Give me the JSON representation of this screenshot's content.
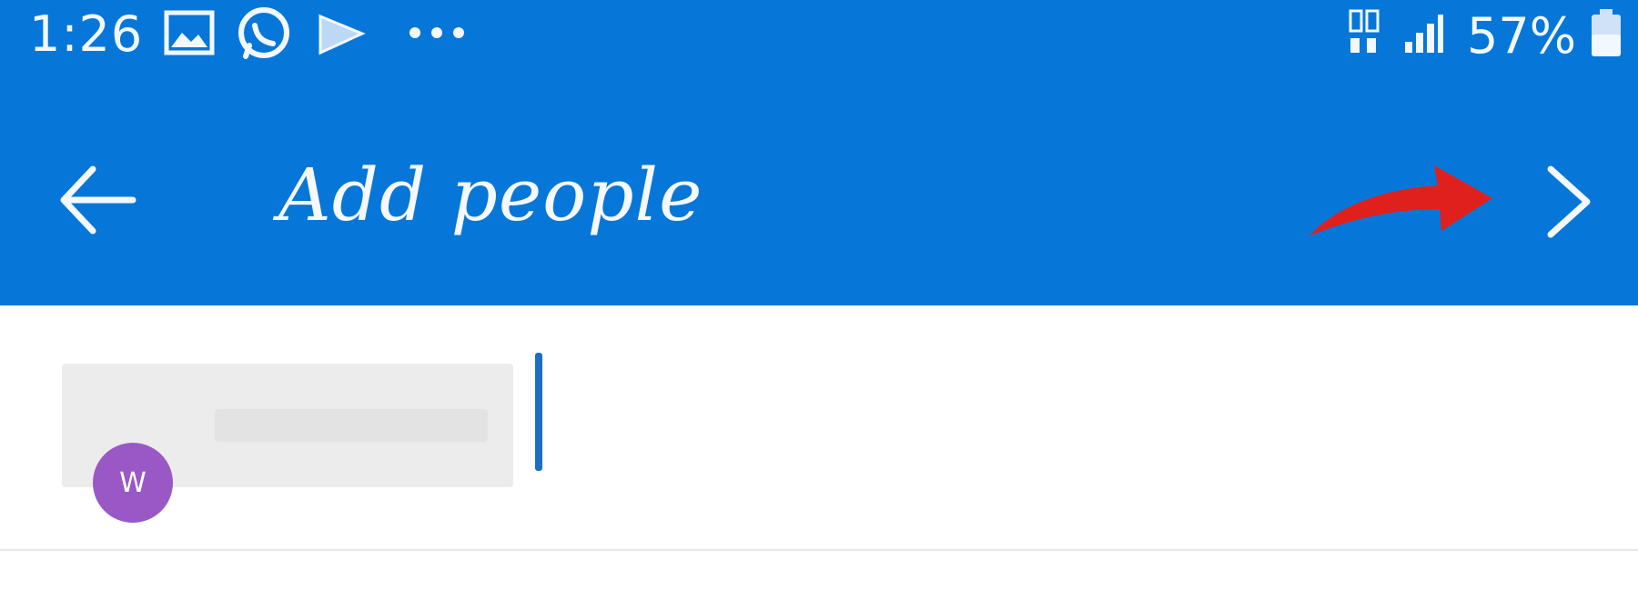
{
  "status_bar": {
    "time": "1:26",
    "battery_percent": "57%",
    "notification_icons": [
      "gallery-icon",
      "whatsapp-icon",
      "play-icon",
      "more-dots-icon"
    ],
    "status_icons": [
      "network-icon",
      "signal-icon",
      "battery-icon"
    ]
  },
  "toolbar": {
    "title": "Add people",
    "back_icon": "back-arrow-icon",
    "next_icon": "chevron-right-icon",
    "annotation": "red-arrow-annotation"
  },
  "recipients": {
    "chips": [
      {
        "avatar_initials": "W"
      }
    ]
  },
  "colors": {
    "appbar": "#0677d8",
    "avatar": "#9a58c6",
    "annotation_arrow": "#e0201d",
    "cursor": "#1d6ec7"
  }
}
